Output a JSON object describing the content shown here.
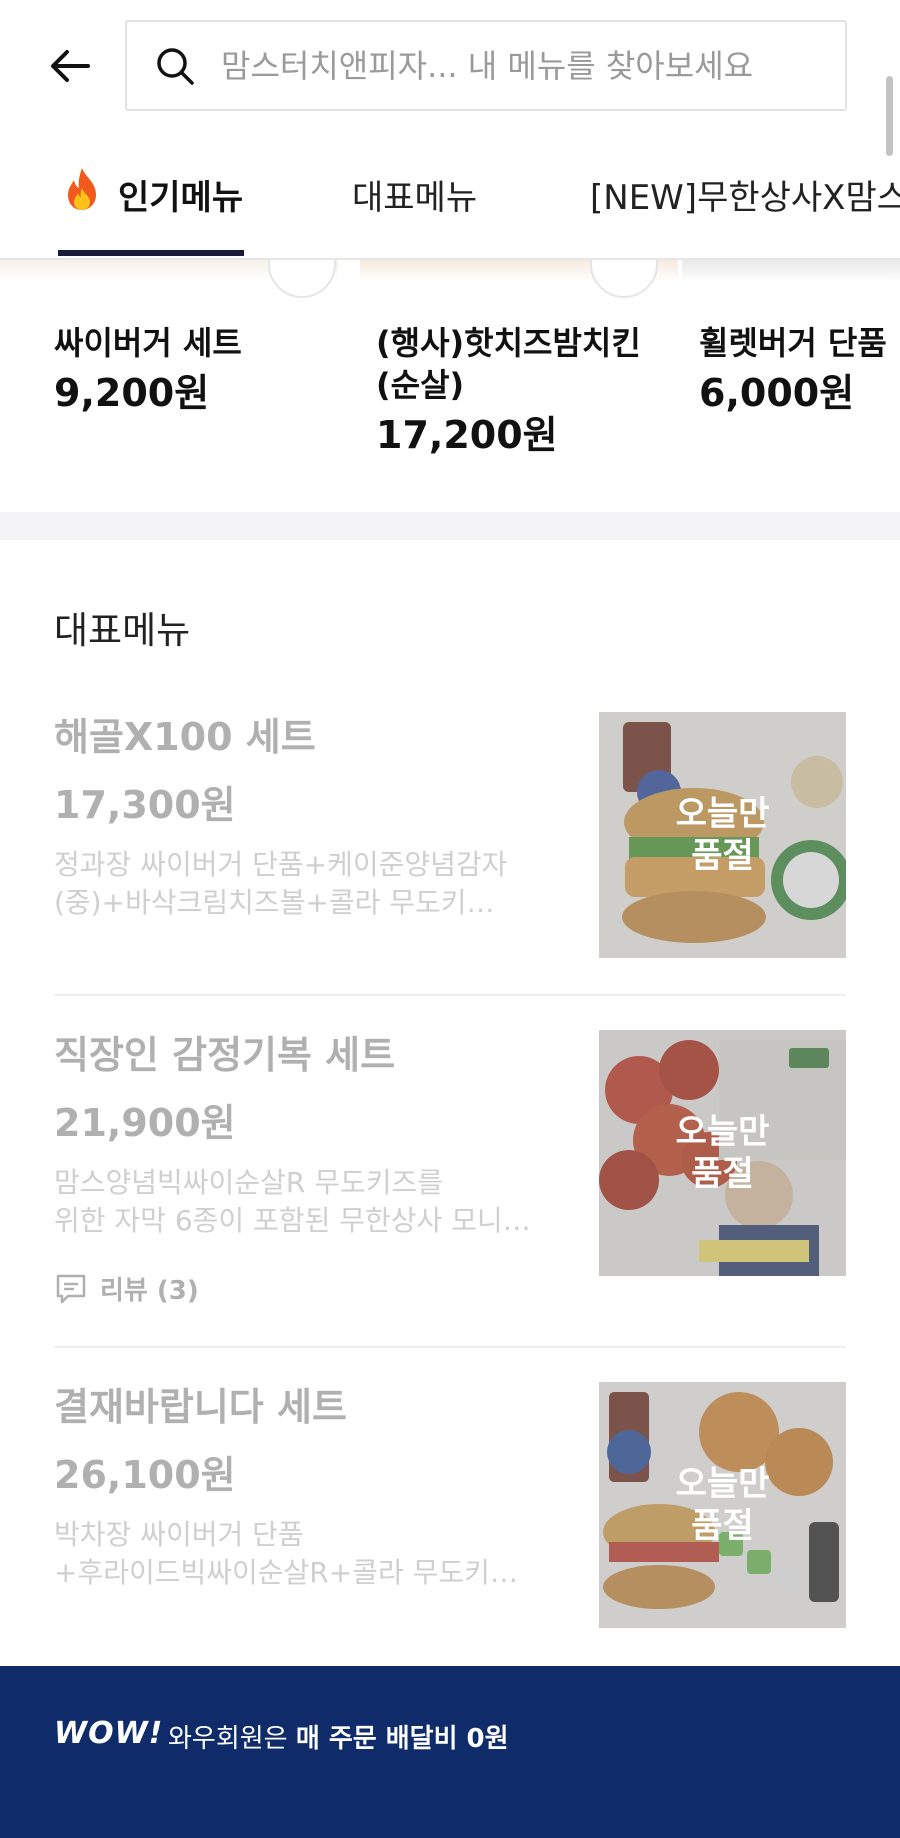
{
  "header": {
    "search_placeholder": "맘스터치앤피자... 내 메뉴를 찾아보세요"
  },
  "tabs": [
    {
      "label": "인기메뉴",
      "active": true
    },
    {
      "label": "대표메뉴",
      "active": false
    },
    {
      "label": "[NEW]무한상사X맘스",
      "active": false
    }
  ],
  "popular": [
    {
      "name": "싸이버거 세트",
      "price": "9,200원"
    },
    {
      "name_line1": "(행사)핫치즈밤치킨",
      "name_line2": "(순살)",
      "price": "17,200원"
    },
    {
      "name": "휠렛버거 단품",
      "price": "6,000원"
    }
  ],
  "section": {
    "title": "대표메뉴"
  },
  "menu": [
    {
      "name": "해골X100 세트",
      "price": "17,300원",
      "desc_line1": "정과장 싸이버거 단품+케이준양념감자",
      "desc_line2": "(중)+바삭크림치즈볼+콜라      무도키…",
      "soldout_line1": "오늘만",
      "soldout_line2": "품절"
    },
    {
      "name": "직장인 감정기복 세트",
      "price": "21,900원",
      "desc_line1": "맘스양념빅싸이순살R       무도키즈를",
      "desc_line2": "위한 자막 6종이 포함된 무한상사 모니…",
      "review": "리뷰 (3)",
      "soldout_line1": "오늘만",
      "soldout_line2": "품절"
    },
    {
      "name": "결재바랍니다 세트",
      "price": "26,100원",
      "desc_line1": "박차장 싸이버거 단품",
      "desc_line2": "+후라이드빅싸이순살R+콜라   무도키…",
      "soldout_line1": "오늘만",
      "soldout_line2": "품절"
    }
  ],
  "footer": {
    "logo": "WOW!",
    "text_prefix": "와우회원은 ",
    "text_bold": "매 주문 배달비 0원"
  },
  "colors": {
    "footer_bg": "#0f2b6a",
    "tab_underline": "#1a1a3a"
  }
}
